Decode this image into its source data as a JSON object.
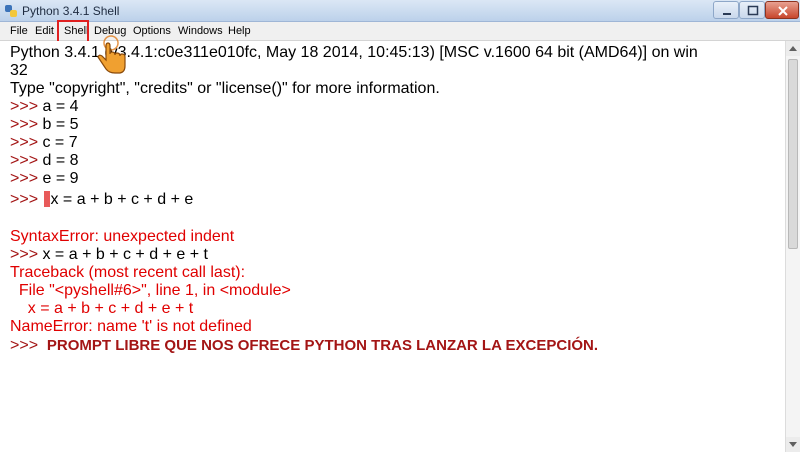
{
  "window": {
    "title": "Python 3.4.1 Shell",
    "icons": {
      "app": "python-icon",
      "minimize": "minimize-icon",
      "maximize": "maximize-icon",
      "close": "close-icon"
    }
  },
  "menu": {
    "file": "File",
    "edit": "Edit",
    "shell": "Shell",
    "debug": "Debug",
    "options": "Options",
    "windows": "Windows",
    "help": "Help"
  },
  "console": {
    "line1": "Python 3.4.1 (v3.4.1:c0e311e010fc, May 18 2014, 10:45:13) [MSC v.1600 64 bit (AMD64)] on win",
    "line2": "32",
    "line3": "Type \"copyright\", \"credits\" or \"license()\" for more information.",
    "prompt": ">>> ",
    "cmd_a": "a = 4",
    "cmd_b": "b = 5",
    "cmd_c": "c = 7",
    "cmd_d": "d = 8",
    "cmd_e": "e = 9",
    "cmd_x_indented": "x = a + b + c + d + e",
    "syntax_error": "SyntaxError: unexpected indent",
    "cmd_x_t": "x = a + b + c + d + e + t",
    "traceback_header": "Traceback (most recent call last):",
    "traceback_file": "  File \"<pyshell#6>\", line 1, in <module>",
    "traceback_code": "    x = a + b + c + d + e + t",
    "name_error": "NameError: name 't' is not defined",
    "final_prompt": ">>>  ",
    "annotation": "PROMPT LIBRE QUE NOS OFRECE PYTHON TRAS LANZAR LA EXCEPCIÓN."
  },
  "colors": {
    "prompt": "#a31515",
    "error": "#e00000",
    "output": "#000000",
    "highlight_box": "#e02020"
  }
}
